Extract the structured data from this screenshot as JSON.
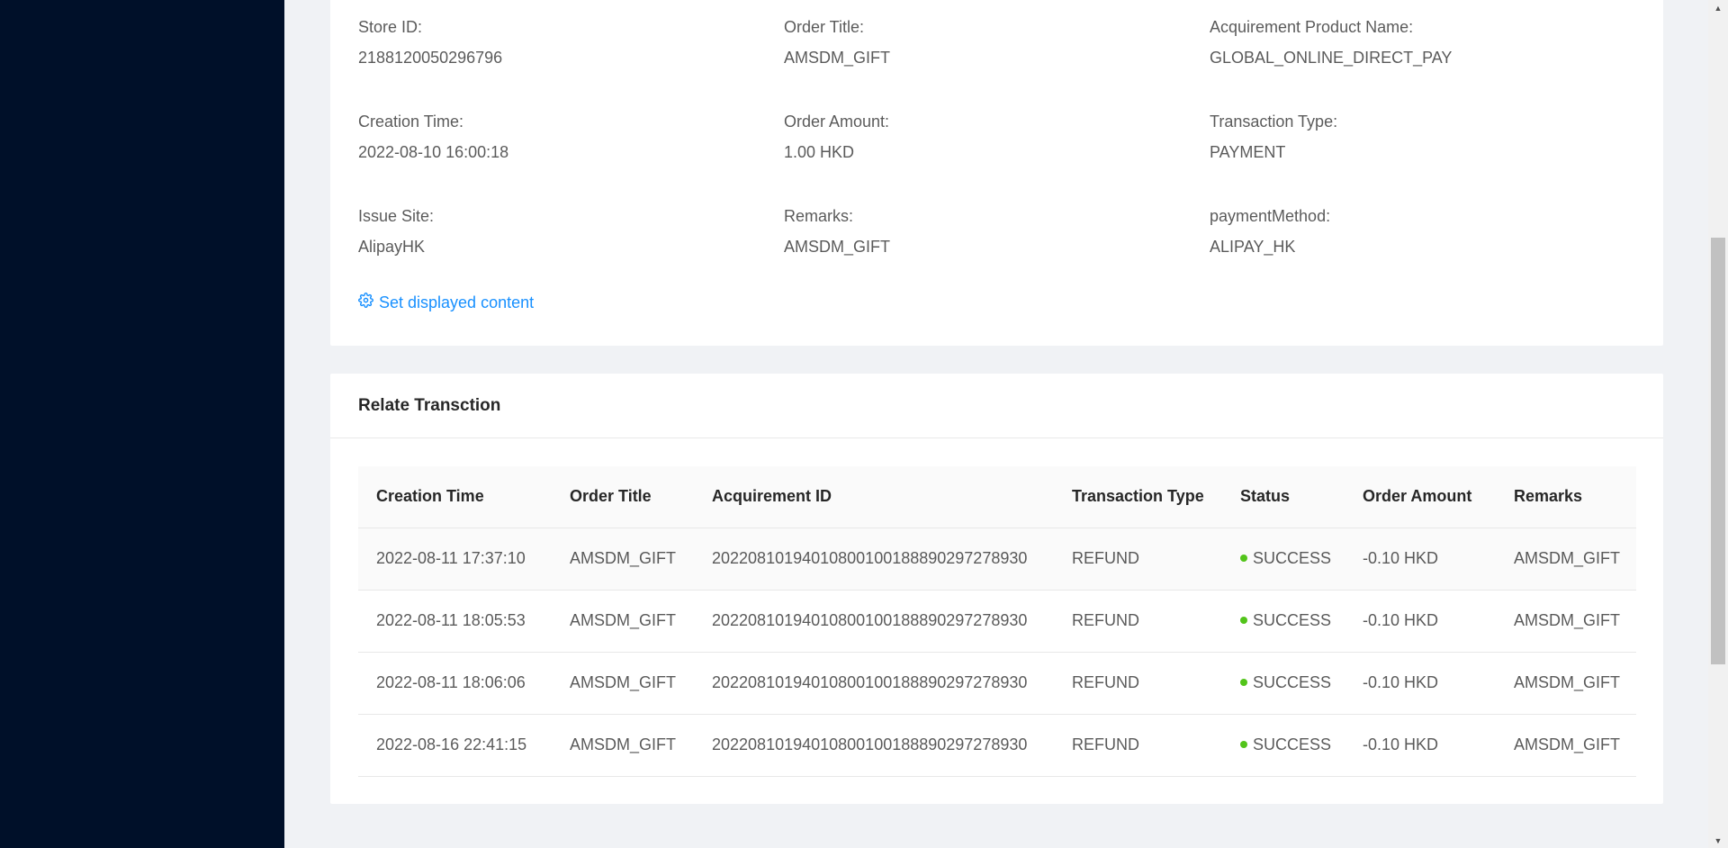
{
  "details": [
    {
      "label": "Store ID:",
      "value": "2188120050296796"
    },
    {
      "label": "Order Title:",
      "value": "AMSDM_GIFT"
    },
    {
      "label": "Acquirement Product Name:",
      "value": "GLOBAL_ONLINE_DIRECT_PAY"
    },
    {
      "label": "Creation Time:",
      "value": "2022-08-10 16:00:18"
    },
    {
      "label": "Order Amount:",
      "value": "1.00 HKD"
    },
    {
      "label": "Transaction Type:",
      "value": "PAYMENT"
    },
    {
      "label": "Issue Site:",
      "value": "AlipayHK"
    },
    {
      "label": "Remarks:",
      "value": "AMSDM_GIFT"
    },
    {
      "label": "paymentMethod:",
      "value": "ALIPAY_HK"
    }
  ],
  "set_displayed_content": "Set displayed content",
  "relate": {
    "title": "Relate Transction",
    "columns": [
      "Creation Time",
      "Order Title",
      "Acquirement ID",
      "Transaction Type",
      "Status",
      "Order Amount",
      "Remarks"
    ],
    "rows": [
      [
        "2022-08-11 17:37:10",
        "AMSDM_GIFT",
        "20220810194010800100188890297278930",
        "REFUND",
        "SUCCESS",
        "-0.10 HKD",
        "AMSDM_GIFT"
      ],
      [
        "2022-08-11 18:05:53",
        "AMSDM_GIFT",
        "20220810194010800100188890297278930",
        "REFUND",
        "SUCCESS",
        "-0.10 HKD",
        "AMSDM_GIFT"
      ],
      [
        "2022-08-11 18:06:06",
        "AMSDM_GIFT",
        "20220810194010800100188890297278930",
        "REFUND",
        "SUCCESS",
        "-0.10 HKD",
        "AMSDM_GIFT"
      ],
      [
        "2022-08-16 22:41:15",
        "AMSDM_GIFT",
        "20220810194010800100188890297278930",
        "REFUND",
        "SUCCESS",
        "-0.10 HKD",
        "AMSDM_GIFT"
      ]
    ]
  },
  "colors": {
    "sidebar": "#001029",
    "link": "#1890ff",
    "success": "#52c41a"
  },
  "icons": {
    "settings": "gear-icon",
    "status": "status-dot"
  }
}
